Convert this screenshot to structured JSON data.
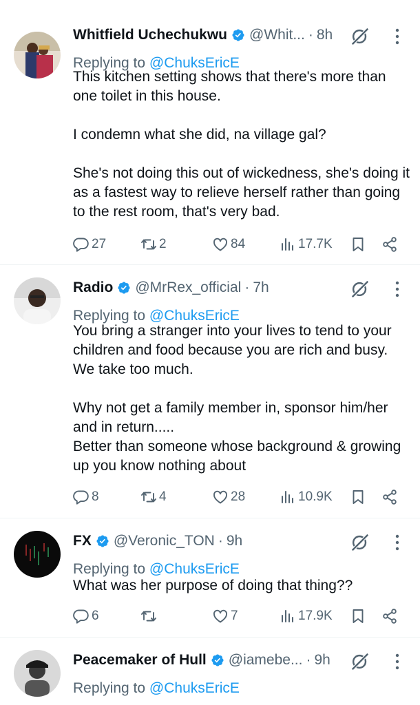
{
  "colors": {
    "accent": "#1d9bf0",
    "secondary_text": "#536471",
    "primary_text": "#0f1419",
    "divider": "#eff3f4"
  },
  "tweets": [
    {
      "name": "Whitfield Uchechukwu",
      "handle": "@Whit...",
      "time": "8h",
      "reply_prefix": "Replying to",
      "reply_to": "@ChuksEricE",
      "lines": [
        "This kitchen setting shows that there's more than one toilet in this house.",
        "",
        "I condemn what she did, na village gal?",
        "",
        "She's not doing this out of wickedness, she's doing it as a fastest way to relieve herself rather than going to the rest room, that's very bad."
      ],
      "replies": "27",
      "retweets": "2",
      "likes": "84",
      "views": "17.7K"
    },
    {
      "name": "Radio",
      "handle": "@MrRex_official",
      "time": "7h",
      "reply_prefix": "Replying to",
      "reply_to": "@ChuksEricE",
      "lines": [
        "You bring a stranger into your lives to tend to your children and food because you are rich and busy. We take too much.",
        "",
        "Why not get a family member in, sponsor him/her and in return.....",
        "Better than someone whose background & growing up you know nothing about"
      ],
      "replies": "8",
      "retweets": "4",
      "likes": "28",
      "views": "10.9K"
    },
    {
      "name": "FX",
      "handle": "@Veronic_TON",
      "time": "9h",
      "reply_prefix": "Replying to",
      "reply_to": "@ChuksEricE",
      "lines": [
        "What was her purpose of doing that thing??"
      ],
      "replies": "6",
      "retweets": "",
      "likes": "7",
      "views": "17.9K"
    },
    {
      "name": "Peacemaker of Hull",
      "handle": "@iamebe...",
      "time": "9h",
      "reply_prefix": "Replying to",
      "reply_to": "@ChuksEricE",
      "lines": [],
      "replies": "",
      "retweets": "",
      "likes": "",
      "views": ""
    }
  ]
}
